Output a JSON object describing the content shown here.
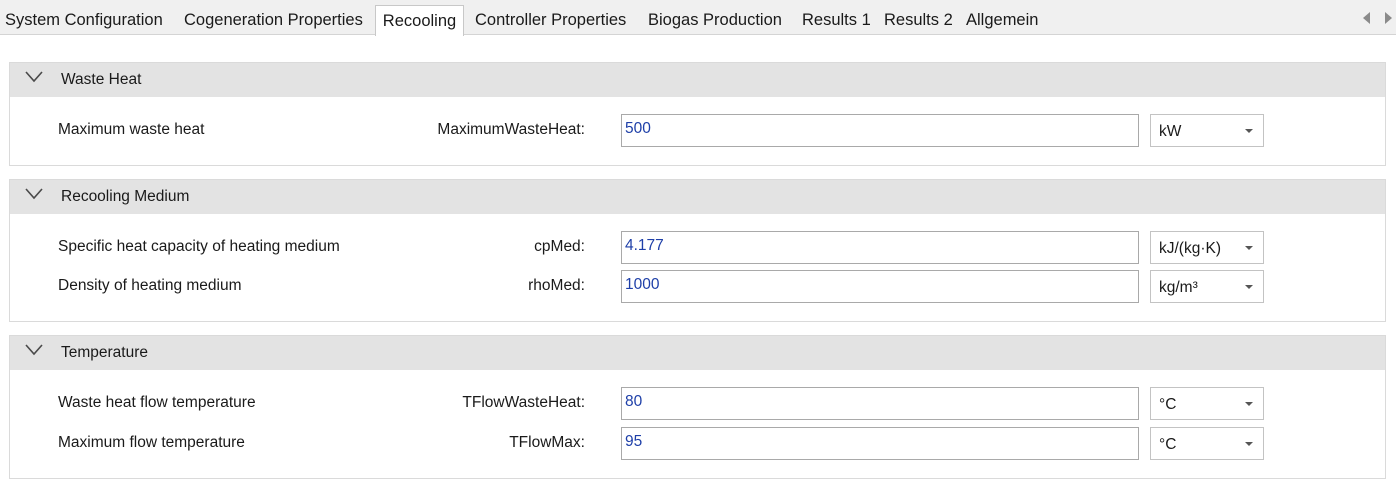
{
  "tabs": [
    {
      "label": "System Configuration",
      "active": false
    },
    {
      "label": "Cogeneration Properties",
      "active": false
    },
    {
      "label": "Recooling",
      "active": true
    },
    {
      "label": "Controller Properties",
      "active": false
    },
    {
      "label": "Biogas Production",
      "active": false
    },
    {
      "label": "Results 1",
      "active": false
    },
    {
      "label": "Results 2",
      "active": false
    },
    {
      "label": "Allgemein",
      "active": false
    }
  ],
  "groups": [
    {
      "title": "Waste Heat",
      "rows": [
        {
          "label": "Maximum waste heat",
          "variable": "MaximumWasteHeat:",
          "value": "500",
          "unit": "kW"
        }
      ]
    },
    {
      "title": "Recooling Medium",
      "rows": [
        {
          "label": "Specific heat capacity of heating medium",
          "variable": "cpMed:",
          "value": "4.177",
          "unit": "kJ/(kg·K)"
        },
        {
          "label": "Density of heating medium",
          "variable": "rhoMed:",
          "value": "1000",
          "unit": "kg/m³"
        }
      ]
    },
    {
      "title": "Temperature",
      "rows": [
        {
          "label": "Waste heat flow temperature",
          "variable": "TFlowWasteHeat:",
          "value": "80",
          "unit": "°C"
        },
        {
          "label": "Maximum flow temperature",
          "variable": "TFlowMax:",
          "value": "95",
          "unit": "°C"
        }
      ]
    }
  ],
  "icons": {
    "collapse": "chevron-down-icon",
    "scroll_left": "triangle-left-icon",
    "scroll_right": "triangle-right-icon",
    "dropdown": "caret-down-icon"
  },
  "colors": {
    "value_text": "#1e3fa8",
    "group_header_bg": "#e3e3e3",
    "tabstrip_bg": "#f0f0f0"
  }
}
